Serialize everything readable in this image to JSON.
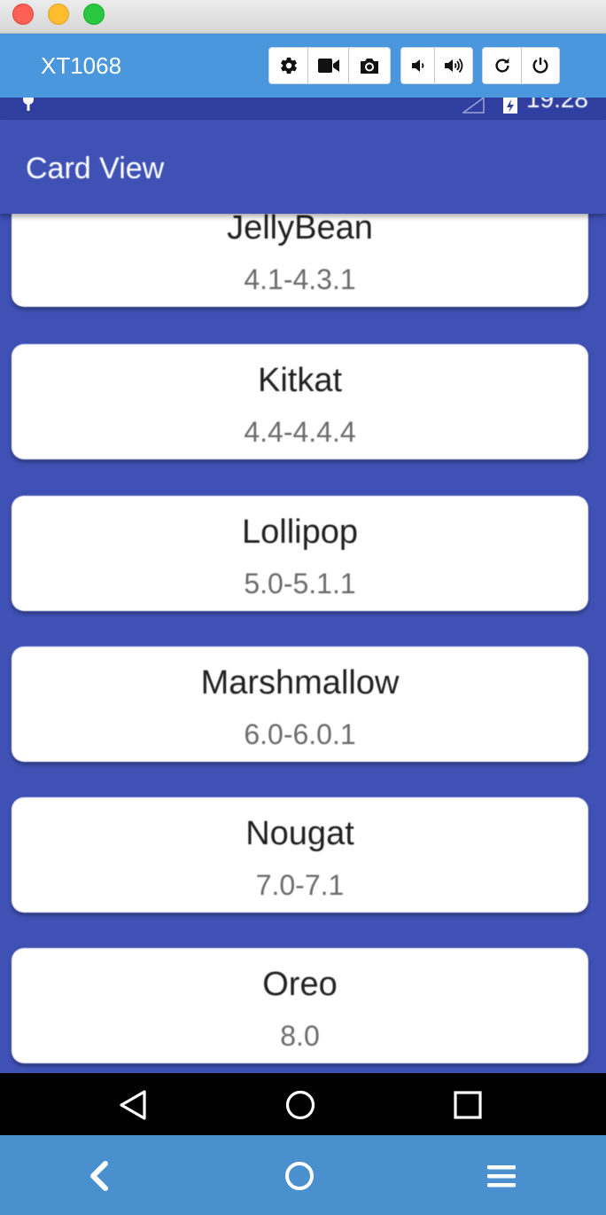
{
  "window": {
    "device_name": "XT1068"
  },
  "toolbar": {
    "groups": [
      {
        "buttons": [
          {
            "icon": "gear-icon"
          },
          {
            "icon": "video-camera-icon"
          },
          {
            "icon": "camera-icon"
          }
        ]
      },
      {
        "buttons": [
          {
            "icon": "volume-down-icon"
          },
          {
            "icon": "volume-up-icon"
          }
        ]
      },
      {
        "buttons": [
          {
            "icon": "rotate-icon"
          },
          {
            "icon": "power-icon"
          }
        ]
      }
    ]
  },
  "status_bar": {
    "time": "19:28"
  },
  "app": {
    "title": "Card View",
    "cards": [
      {
        "name": "JellyBean",
        "version": "4.1-4.3.1"
      },
      {
        "name": "Kitkat",
        "version": "4.4-4.4.4"
      },
      {
        "name": "Lollipop",
        "version": "5.0-5.1.1"
      },
      {
        "name": "Marshmallow",
        "version": "6.0-6.0.1"
      },
      {
        "name": "Nougat",
        "version": "7.0-7.1"
      },
      {
        "name": "Oreo",
        "version": "8.0"
      }
    ]
  },
  "android_nav": {
    "icons": [
      "back-triangle-icon",
      "home-circle-icon",
      "recents-square-icon"
    ]
  },
  "emulator_nav": {
    "icons": [
      "chevron-left-icon",
      "circle-icon",
      "hamburger-menu-icon"
    ]
  },
  "colors": {
    "primary": "#3f51b5",
    "primary_dark": "#303f9f",
    "toolbar": "#4a97dd"
  }
}
